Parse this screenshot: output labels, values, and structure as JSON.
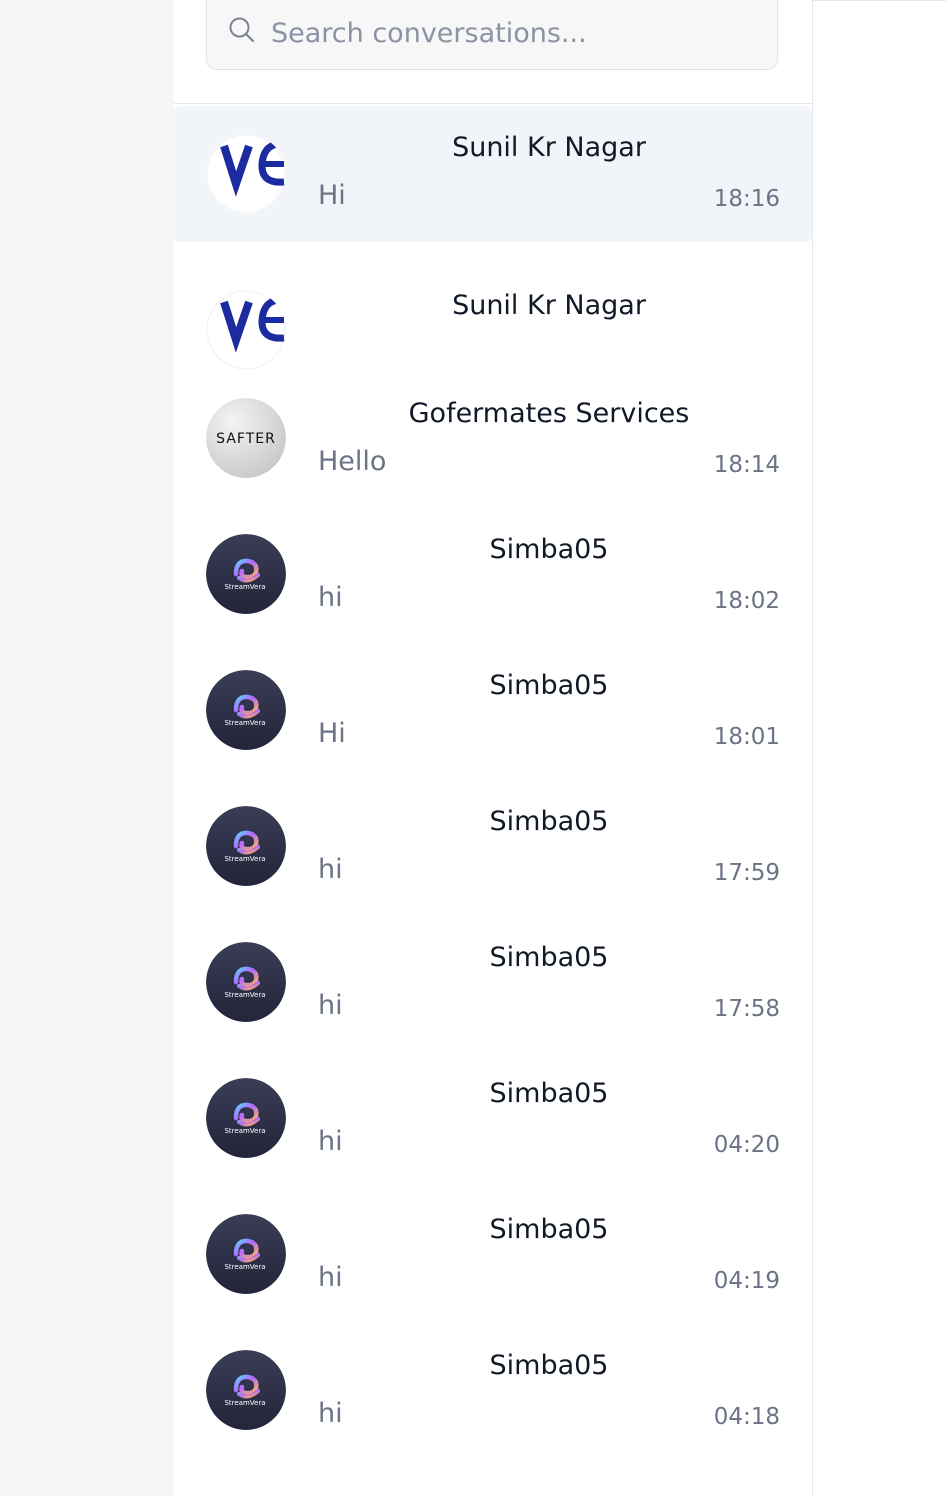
{
  "search": {
    "placeholder": "Search conversations..."
  },
  "conversations": [
    {
      "name": "Sunil Kr Nagar",
      "preview": "Hi",
      "time": "18:16",
      "avatar": "ve-logo",
      "active": true
    },
    {
      "name": "Sunil Kr Nagar",
      "preview": "",
      "time": "",
      "avatar": "ve-logo",
      "active": false
    },
    {
      "name": "Gofermates Services",
      "preview": "Hello",
      "time": "18:14",
      "avatar": "safter-logo",
      "active": false
    },
    {
      "name": "Simba05",
      "preview": "hi",
      "time": "18:02",
      "avatar": "streamvera-logo",
      "active": false
    },
    {
      "name": "Simba05",
      "preview": "Hi",
      "time": "18:01",
      "avatar": "streamvera-logo",
      "active": false
    },
    {
      "name": "Simba05",
      "preview": "hi",
      "time": "17:59",
      "avatar": "streamvera-logo",
      "active": false
    },
    {
      "name": "Simba05",
      "preview": "hi",
      "time": "17:58",
      "avatar": "streamvera-logo",
      "active": false
    },
    {
      "name": "Simba05",
      "preview": "hi",
      "time": "04:20",
      "avatar": "streamvera-logo",
      "active": false
    },
    {
      "name": "Simba05",
      "preview": "hi",
      "time": "04:19",
      "avatar": "streamvera-logo",
      "active": false
    },
    {
      "name": "Simba05",
      "preview": "hi",
      "time": "04:18",
      "avatar": "streamvera-logo",
      "active": false
    }
  ],
  "logos": {
    "safter_text": "SAFTER",
    "streamvera_text": "StreamVera"
  },
  "colors": {
    "active_row": "#f1f4f9",
    "name_text": "#111827",
    "muted_text": "#6b7385",
    "ve_blue": "#1c2ca0",
    "streamvera_bg": "#2e3148"
  }
}
